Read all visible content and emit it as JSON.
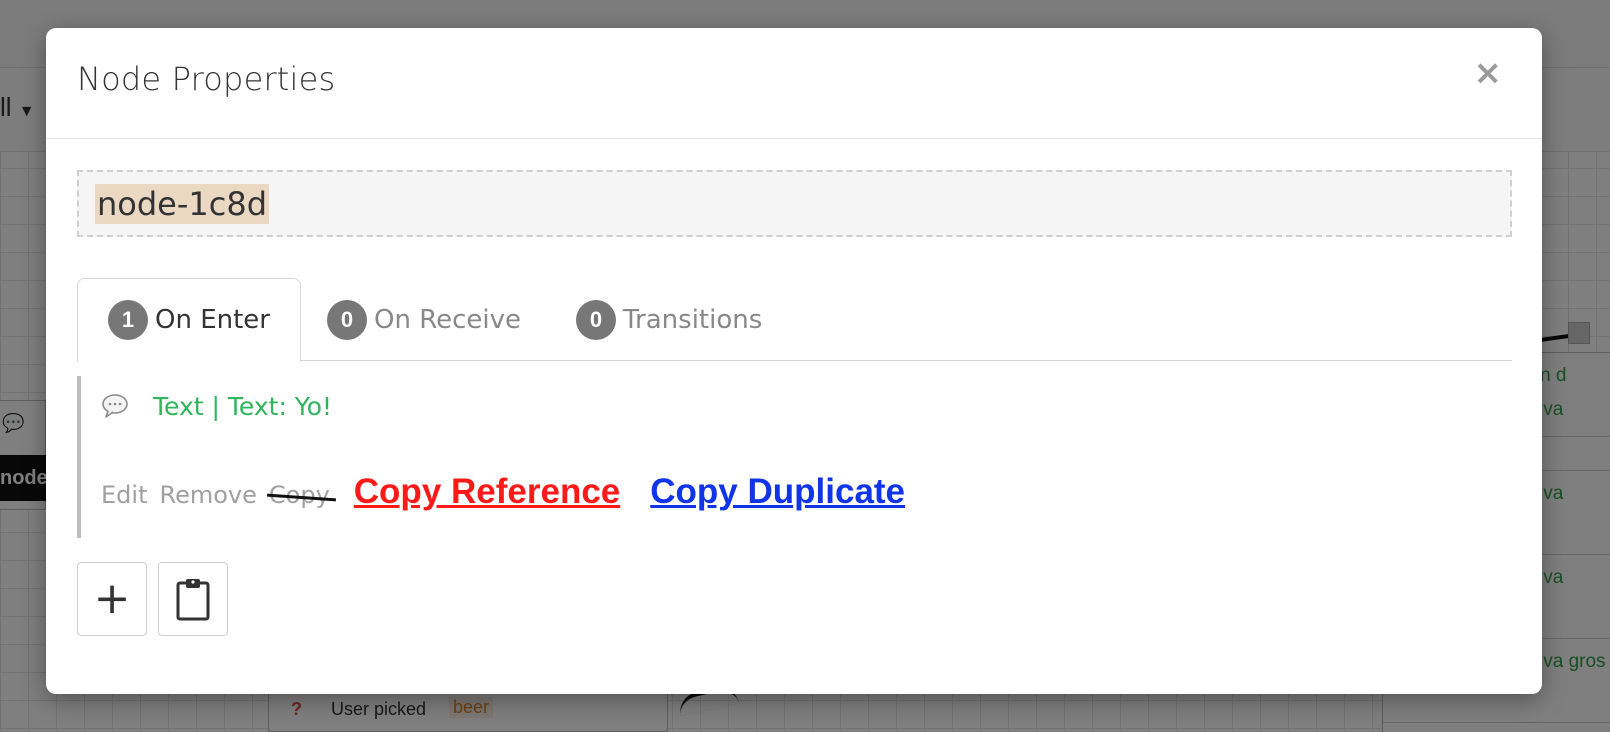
{
  "background": {
    "dropdown_label": "ll",
    "left_node_label": "node",
    "bottom_node": {
      "prefix": "?",
      "label": "User picked",
      "value": "beer"
    },
    "right_node_rows": [
      "t: Bon d",
      "t: Tu va",
      "t: Tu va",
      "t: Tu va",
      "t: Tu va gros"
    ]
  },
  "modal": {
    "title": "Node Properties",
    "close_glyph": "×",
    "node_name": "node-1c8d",
    "tabs": [
      {
        "count": "1",
        "label": "On Enter",
        "active": true
      },
      {
        "count": "0",
        "label": "On Receive",
        "active": false
      },
      {
        "count": "0",
        "label": "Transitions",
        "active": false
      }
    ],
    "action": {
      "icon": "speech-bubble-icon",
      "summary": "Text | Text: Yo!",
      "links": {
        "edit": "Edit",
        "remove": "Remove",
        "copy": "Copy",
        "copy_reference": "Copy Reference",
        "copy_duplicate": "Copy Duplicate"
      }
    },
    "buttons": {
      "add_icon": "plus-icon",
      "add_glyph": "+",
      "paste_icon": "clipboard-icon"
    }
  },
  "colors": {
    "summary_green": "#2fb55b",
    "copy_reference_red": "#ff1a1a",
    "copy_duplicate_blue": "#1034e8",
    "tab_badge": "#777777",
    "node_name_highlight": "#ead8c3"
  }
}
